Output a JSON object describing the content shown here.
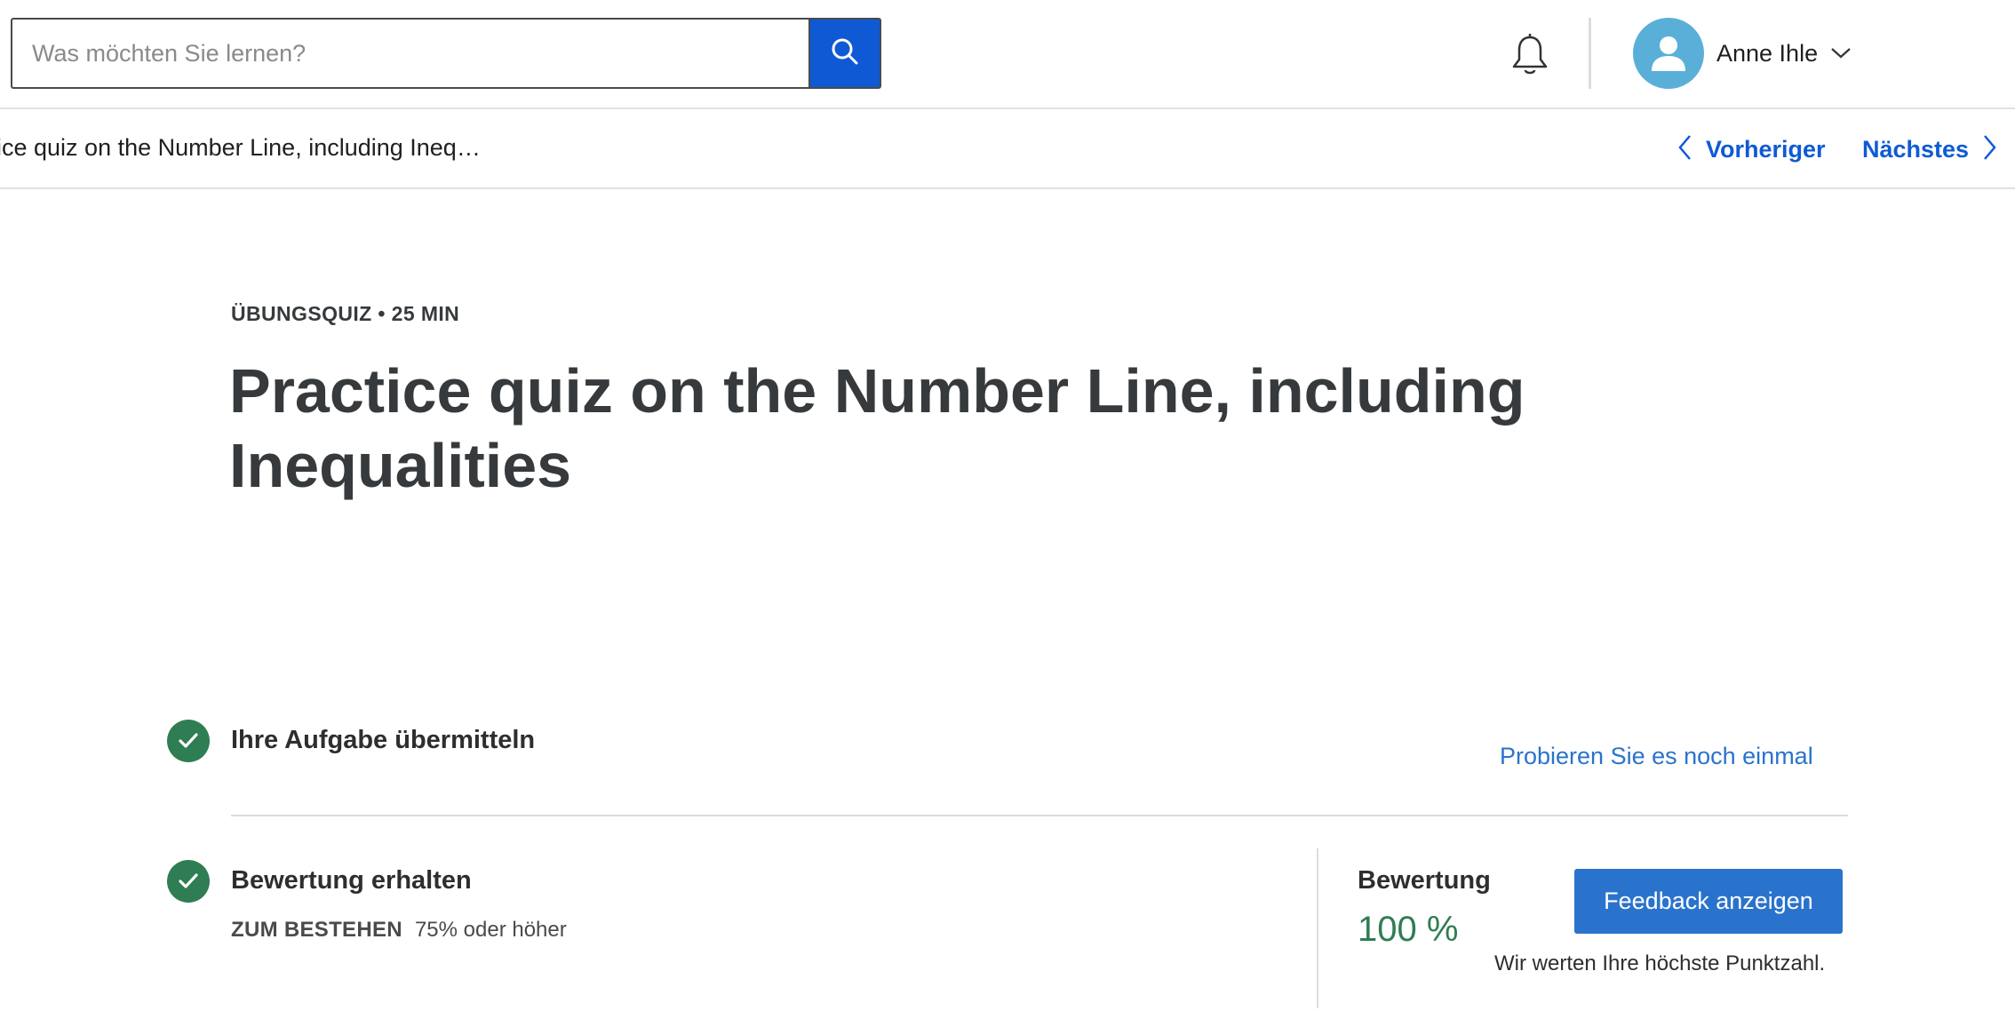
{
  "header": {
    "search": {
      "placeholder": "Was möchten Sie lernen?",
      "value": ""
    },
    "icons": {
      "search": "search-icon",
      "notifications": "bell-icon",
      "avatar": "user-avatar-icon",
      "menu": "chevron-down-icon"
    },
    "user": {
      "name": "Anne Ihle"
    }
  },
  "subnav": {
    "breadcrumb": "ice quiz on the Number Line, including Ineq…",
    "prev_label": "Vorheriger",
    "next_label": "Nächstes"
  },
  "main": {
    "eyebrow": "ÜBUNGSQUIZ • 25 MIN",
    "title": "Practice quiz on the Number Line, including Inequalities",
    "steps": [
      {
        "label": "Ihre Aufgabe übermitteln",
        "status": "complete",
        "action_label": "Probieren Sie es noch einmal"
      },
      {
        "label": "Bewertung erhalten",
        "status": "complete",
        "pass_label": "ZUM BESTEHEN",
        "pass_value": "75% oder höher"
      }
    ],
    "grade": {
      "label": "Bewertung",
      "value": "100 %",
      "button_label": "Feedback anzeigen",
      "note": "Wir werten Ihre höchste Punktzahl."
    }
  },
  "colors": {
    "accent": "#0f5ad4",
    "link": "#2a73cc",
    "success": "#2f7d52",
    "avatar": "#5aafd9",
    "text": "#373a3c"
  }
}
